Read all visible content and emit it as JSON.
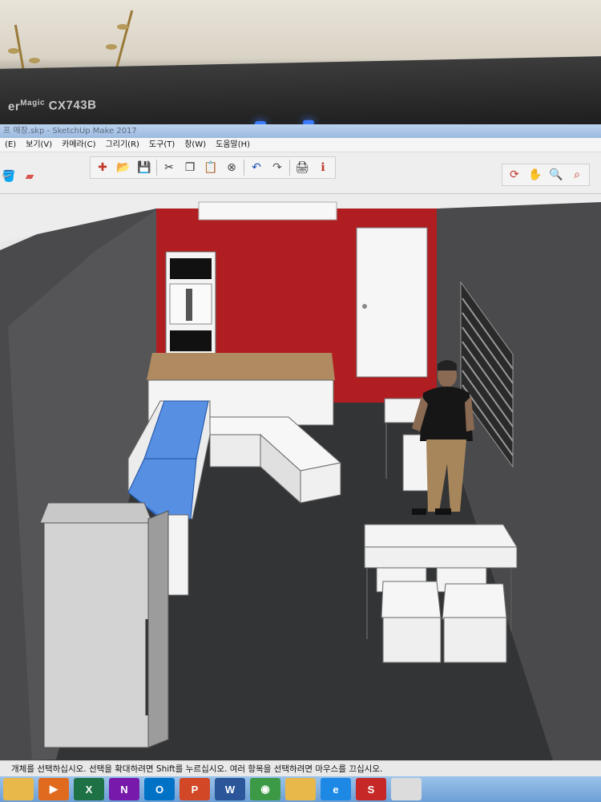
{
  "monitor": {
    "brand_prefix": "er",
    "brand_super": "Magic",
    "model": "CX743B"
  },
  "window": {
    "title": "프 매장.skp - SketchUp Make 2017"
  },
  "menu": {
    "items": [
      {
        "label": "(E)"
      },
      {
        "label": "보기(V)"
      },
      {
        "label": "카메라(C)"
      },
      {
        "label": "그리기(R)"
      },
      {
        "label": "도구(T)"
      },
      {
        "label": "창(W)"
      },
      {
        "label": "도움말(H)"
      }
    ]
  },
  "toolbar": {
    "main": [
      {
        "icon": "new-file-icon",
        "glyph": "✚",
        "color": "#c0392b"
      },
      {
        "icon": "open-folder-icon",
        "glyph": "📂",
        "color": "#e0a000"
      },
      {
        "icon": "save-icon",
        "glyph": "💾",
        "color": "#2c4a8a"
      },
      {
        "icon": "cut-icon",
        "glyph": "✂",
        "color": "#333333"
      },
      {
        "icon": "copy-icon",
        "glyph": "❐",
        "color": "#333333"
      },
      {
        "icon": "paste-icon",
        "glyph": "📋",
        "color": "#333333"
      },
      {
        "icon": "erase-icon",
        "glyph": "⊗",
        "color": "#444444"
      },
      {
        "icon": "undo-icon",
        "glyph": "↶",
        "color": "#1a4fb5"
      },
      {
        "icon": "redo-icon",
        "glyph": "↷",
        "color": "#555555"
      },
      {
        "icon": "print-icon",
        "glyph": "🖨",
        "color": "#222222"
      },
      {
        "icon": "model-info-icon",
        "glyph": "ℹ",
        "color": "#c0392b"
      }
    ],
    "left": [
      {
        "icon": "paint-bucket-icon",
        "glyph": "🪣",
        "color": "#c0392b"
      },
      {
        "icon": "eraser-icon",
        "glyph": "▰",
        "color": "#d9534f"
      }
    ],
    "right": [
      {
        "icon": "orbit-icon",
        "glyph": "⟳",
        "color": "#c0392b"
      },
      {
        "icon": "pan-icon",
        "glyph": "✋",
        "color": "#d59a3a"
      },
      {
        "icon": "zoom-icon",
        "glyph": "🔍",
        "color": "#1a4fb5"
      },
      {
        "icon": "zoom-window-icon",
        "glyph": "⌕",
        "color": "#c0392b"
      }
    ]
  },
  "scene": {
    "colors": {
      "floor": "#333436",
      "accent_wall": "#b01e22",
      "side_wall": "#4a4a4c",
      "display_glass": "#3d7fe0",
      "counter_top": "#b08a60",
      "white_furniture": "#f4f4f4"
    }
  },
  "status": {
    "hint": "개체를 선택하십시오. 선택을 확대하려면 Shift를 누르십시오. 여러 항목을 선택하려면 마우스를 끄십시오."
  },
  "taskbar": {
    "apps": [
      {
        "icon": "file-explorer-icon",
        "label": "",
        "color": "#e8b84a"
      },
      {
        "icon": "media-player-icon",
        "label": "▶",
        "color": "#e06b1f"
      },
      {
        "icon": "excel-icon",
        "label": "X",
        "color": "#1e7145"
      },
      {
        "icon": "onenote-icon",
        "label": "N",
        "color": "#7719aa"
      },
      {
        "icon": "outlook-icon",
        "label": "O",
        "color": "#0072c6"
      },
      {
        "icon": "powerpoint-icon",
        "label": "P",
        "color": "#d24726"
      },
      {
        "icon": "word-icon",
        "label": "W",
        "color": "#2b579a"
      },
      {
        "icon": "chrome-icon",
        "label": "◉",
        "color": "#3c9a46"
      },
      {
        "icon": "folder-icon",
        "label": "",
        "color": "#e8b84a"
      },
      {
        "icon": "edge-icon",
        "label": "e",
        "color": "#1e88e5"
      },
      {
        "icon": "sketchup-icon",
        "label": "S",
        "color": "#c62828"
      },
      {
        "icon": "document-icon",
        "label": "",
        "color": "#dcdcdc"
      }
    ]
  }
}
